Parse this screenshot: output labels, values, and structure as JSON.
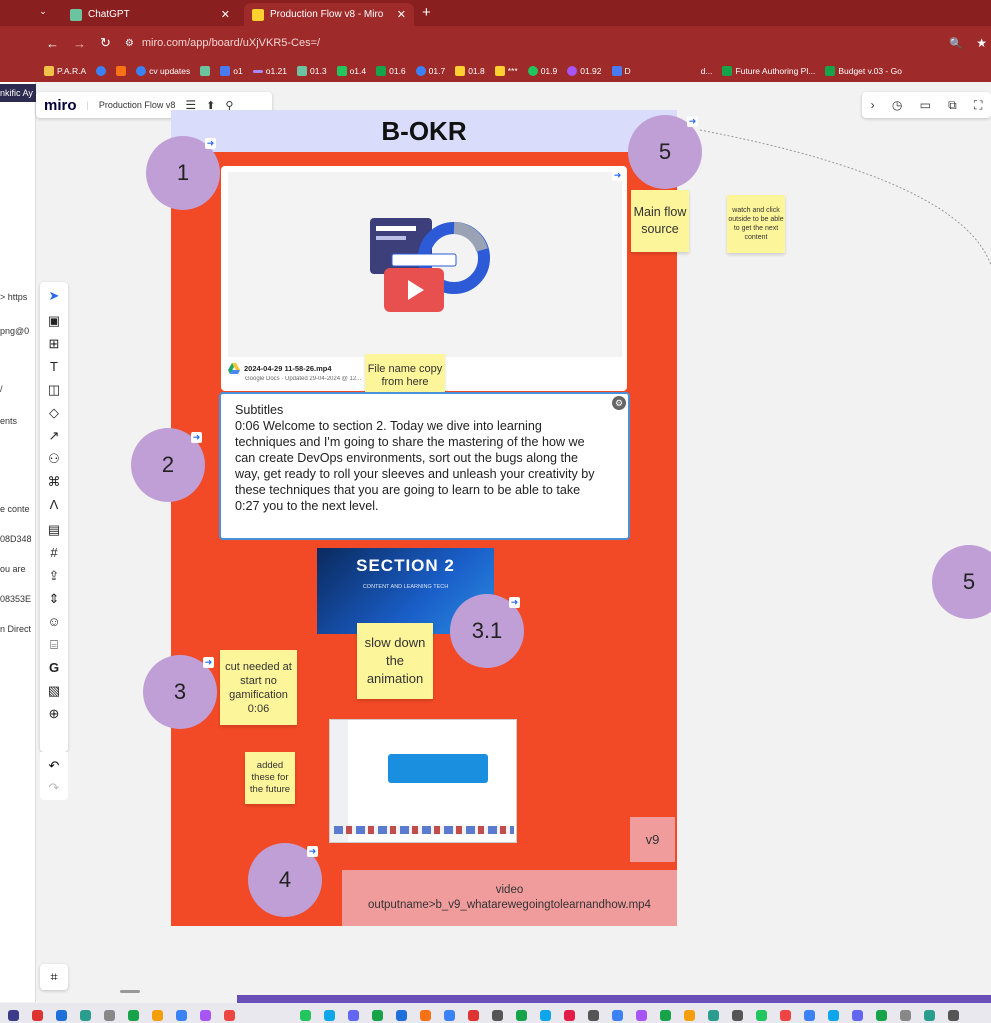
{
  "browser": {
    "tabs": [
      {
        "label": "ChatGPT",
        "active": false
      },
      {
        "label": "Production Flow v8 - Miro",
        "active": true
      }
    ],
    "new_tab": "+",
    "url": "miro.com/app/board/uXjVKR5-Ces=/",
    "bookmarks": [
      "P.A.R.A",
      "",
      "",
      "cv updates",
      "",
      "o1",
      "o1.21",
      "01.3",
      "o1.4",
      "01.6",
      "01.7",
      "01.8",
      "***",
      "01.9",
      "01.92",
      "D",
      "d...",
      "Future Authoring Pl...",
      "Budget v.03 - Go"
    ]
  },
  "background_window": {
    "fragments": [
      "nkific Ay",
      "> https",
      "png@0",
      "/",
      "ents",
      "e conte",
      "08D348",
      "ou are",
      "08353E",
      "n Direct"
    ]
  },
  "miro": {
    "logo": "miro",
    "board_name": "Production Flow v8",
    "menu_icon": "☰",
    "share_icon": "⬆",
    "search_icon": "⚲"
  },
  "board": {
    "frame_title": "B-OKR",
    "circles": {
      "c1": "1",
      "c2": "2",
      "c3": "3",
      "c31": "3.1",
      "c4": "4",
      "c5": "5",
      "c5b": "5"
    },
    "sticky_main_flow": "Main flow source",
    "sticky_watch": "watch and click outside to be able to get the next content",
    "sticky_filename": "File name copy from here",
    "sticky_cut": "cut needed at start no gamification 0:06",
    "sticky_slow": "slow down the animation",
    "sticky_added": "added these for the future",
    "file": {
      "name": "2024-04-29 11-58-26.mp4",
      "meta": "Google Docs · Updated 29-04-2024 @ 12..."
    },
    "subtitles": {
      "heading": "Subtitles",
      "lines": [
        "0:06 Welcome to section 2. Today we dive into learning",
        "techniques and I'm going to share the mastering of the how we",
        "can create DevOps environments, sort out the bugs along the",
        "way, get ready to roll your sleeves and unleash your creativity by",
        "these techniques that you are going to learn to be able to take",
        "0:27 you to the next level."
      ]
    },
    "section_title": "SECTION 2",
    "section_subtitle": "CONTENT AND LEARNING TECH",
    "v9": "v9",
    "video_label": "video",
    "video_output": "outputname>b_v9_whatarewegoingtolearnandhow.mp4"
  },
  "colors": {
    "frame_body": "#f24a26",
    "frame_title": "#d9dcfa",
    "circle": "#c09fd6",
    "sticky": "#fdf59a",
    "pink": "#f19c9c",
    "chrome": "#9e2a2a"
  }
}
